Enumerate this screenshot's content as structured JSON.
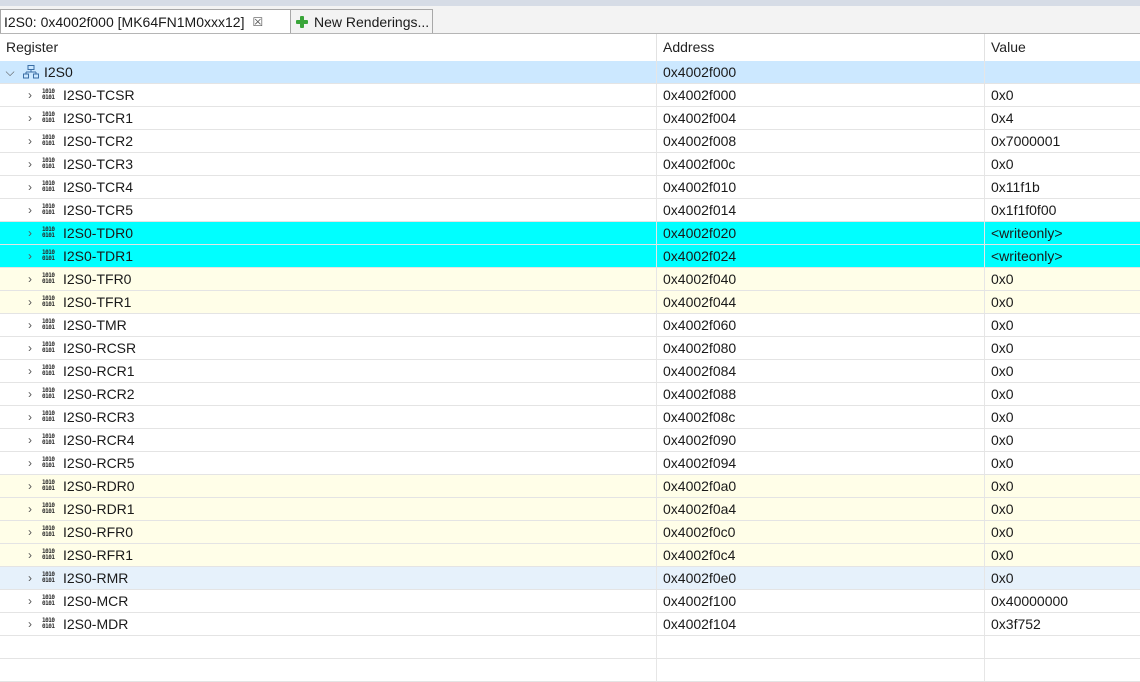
{
  "tabs": {
    "active_label": "I2S0: 0x4002f000 [MK64FN1M0xxx12]",
    "new_renderings_label": "New Renderings..."
  },
  "columns": {
    "register": "Register",
    "address": "Address",
    "value": "Value"
  },
  "peripheral": {
    "name": "I2S0",
    "address": "0x4002f000",
    "value": ""
  },
  "registers": [
    {
      "name": "I2S0-TCSR",
      "address": "0x4002f000",
      "value": "0x0",
      "highlight": ""
    },
    {
      "name": "I2S0-TCR1",
      "address": "0x4002f004",
      "value": "0x4",
      "highlight": ""
    },
    {
      "name": "I2S0-TCR2",
      "address": "0x4002f008",
      "value": "0x7000001",
      "highlight": ""
    },
    {
      "name": "I2S0-TCR3",
      "address": "0x4002f00c",
      "value": "0x0",
      "highlight": ""
    },
    {
      "name": "I2S0-TCR4",
      "address": "0x4002f010",
      "value": "0x11f1b",
      "highlight": ""
    },
    {
      "name": "I2S0-TCR5",
      "address": "0x4002f014",
      "value": "0x1f1f0f00",
      "highlight": ""
    },
    {
      "name": "I2S0-TDR0",
      "address": "0x4002f020",
      "value": "<writeonly>",
      "highlight": "cyan"
    },
    {
      "name": "I2S0-TDR1",
      "address": "0x4002f024",
      "value": "<writeonly>",
      "highlight": "cyan"
    },
    {
      "name": "I2S0-TFR0",
      "address": "0x4002f040",
      "value": "0x0",
      "highlight": "yellow"
    },
    {
      "name": "I2S0-TFR1",
      "address": "0x4002f044",
      "value": "0x0",
      "highlight": "yellow"
    },
    {
      "name": "I2S0-TMR",
      "address": "0x4002f060",
      "value": "0x0",
      "highlight": ""
    },
    {
      "name": "I2S0-RCSR",
      "address": "0x4002f080",
      "value": "0x0",
      "highlight": ""
    },
    {
      "name": "I2S0-RCR1",
      "address": "0x4002f084",
      "value": "0x0",
      "highlight": ""
    },
    {
      "name": "I2S0-RCR2",
      "address": "0x4002f088",
      "value": "0x0",
      "highlight": ""
    },
    {
      "name": "I2S0-RCR3",
      "address": "0x4002f08c",
      "value": "0x0",
      "highlight": ""
    },
    {
      "name": "I2S0-RCR4",
      "address": "0x4002f090",
      "value": "0x0",
      "highlight": ""
    },
    {
      "name": "I2S0-RCR5",
      "address": "0x4002f094",
      "value": "0x0",
      "highlight": ""
    },
    {
      "name": "I2S0-RDR0",
      "address": "0x4002f0a0",
      "value": "0x0",
      "highlight": "yellow"
    },
    {
      "name": "I2S0-RDR1",
      "address": "0x4002f0a4",
      "value": "0x0",
      "highlight": "yellow"
    },
    {
      "name": "I2S0-RFR0",
      "address": "0x4002f0c0",
      "value": "0x0",
      "highlight": "yellow"
    },
    {
      "name": "I2S0-RFR1",
      "address": "0x4002f0c4",
      "value": "0x0",
      "highlight": "yellow"
    },
    {
      "name": "I2S0-RMR",
      "address": "0x4002f0e0",
      "value": "0x0",
      "highlight": "lightblue"
    },
    {
      "name": "I2S0-MCR",
      "address": "0x4002f100",
      "value": "0x40000000",
      "highlight": ""
    },
    {
      "name": "I2S0-MDR",
      "address": "0x4002f104",
      "value": "0x3f752",
      "highlight": ""
    }
  ],
  "colors": {
    "cyan_highlight": "#00ffff",
    "yellow_highlight": "#fffee8",
    "selected_row": "#cce8ff",
    "hover_row": "#e6f1fb"
  },
  "icons": {
    "peripheral": "peripheral-tree-icon",
    "register": "register-bits-icon",
    "close": "close-tab-icon",
    "new_rendering": "plus-icon"
  }
}
